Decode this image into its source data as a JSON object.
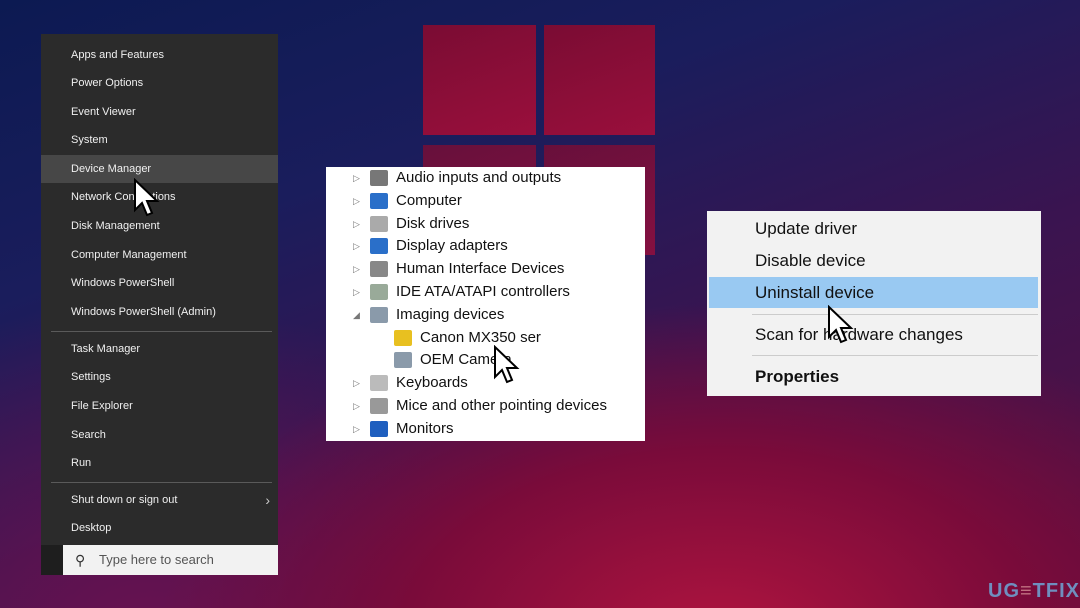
{
  "winx_menu": {
    "items": [
      "Apps and Features",
      "Power Options",
      "Event Viewer",
      "System",
      "Device Manager",
      "Network Connections",
      "Disk Management",
      "Computer Management",
      "Windows PowerShell",
      "Windows PowerShell (Admin)"
    ],
    "items2": [
      "Task Manager",
      "Settings",
      "File Explorer",
      "Search",
      "Run"
    ],
    "items3": [
      "Shut down or sign out",
      "Desktop"
    ],
    "highlighted": "Device Manager",
    "search_placeholder": "Type here to search"
  },
  "device_manager": {
    "rows": [
      {
        "label": "Audio inputs and outputs",
        "icon": "speaker-icon",
        "state": "collapsed"
      },
      {
        "label": "Computer",
        "icon": "computer-icon",
        "state": "collapsed"
      },
      {
        "label": "Disk drives",
        "icon": "disk-icon",
        "state": "collapsed"
      },
      {
        "label": "Display adapters",
        "icon": "display-adapter-icon",
        "state": "collapsed"
      },
      {
        "label": "Human Interface Devices",
        "icon": "hid-icon",
        "state": "collapsed"
      },
      {
        "label": "IDE ATA/ATAPI controllers",
        "icon": "ide-icon",
        "state": "collapsed"
      },
      {
        "label": "Imaging devices",
        "icon": "camera-icon",
        "state": "expanded"
      },
      {
        "label": "Canon MX350 ser",
        "icon": "camera-warning-icon",
        "state": "child"
      },
      {
        "label": "OEM Camera",
        "icon": "camera-icon",
        "state": "child"
      },
      {
        "label": "Keyboards",
        "icon": "keyboard-icon",
        "state": "collapsed"
      },
      {
        "label": "Mice and other pointing devices",
        "icon": "mouse-icon",
        "state": "collapsed"
      },
      {
        "label": "Monitors",
        "icon": "monitor-icon",
        "state": "collapsed"
      }
    ]
  },
  "context_menu": {
    "items": [
      "Update driver",
      "Disable device",
      "Uninstall device",
      "Scan for hardware changes",
      "Properties"
    ],
    "highlighted": "Uninstall device",
    "highlight_color": "#99c9f2"
  },
  "watermark": "UGETFIX"
}
